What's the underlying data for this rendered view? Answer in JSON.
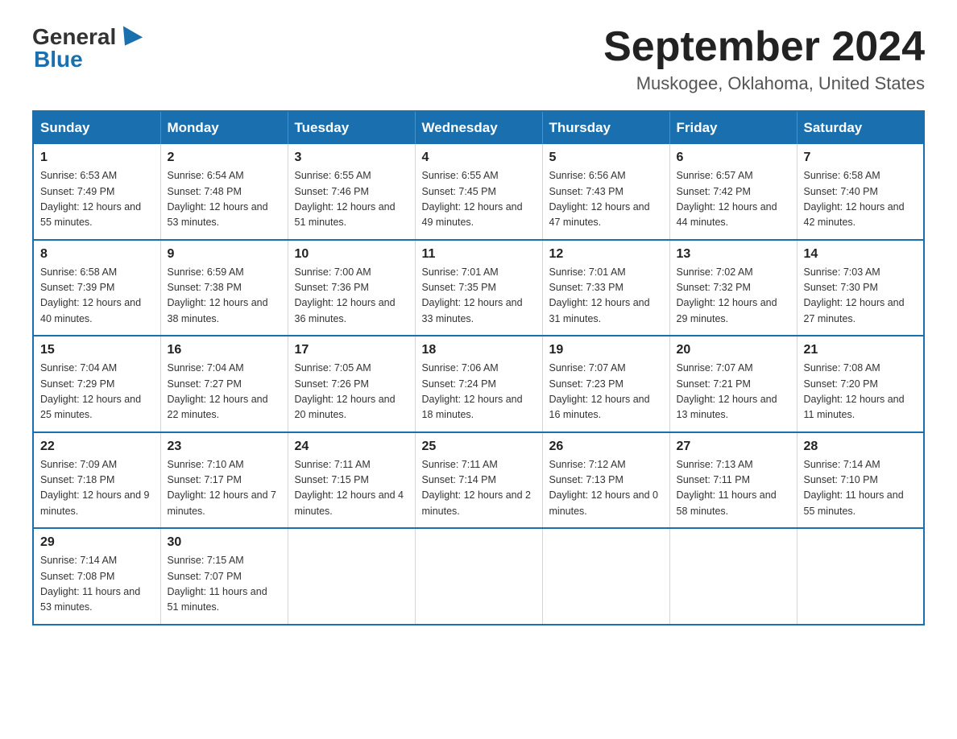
{
  "logo": {
    "general": "General",
    "blue": "Blue"
  },
  "title": "September 2024",
  "location": "Muskogee, Oklahoma, United States",
  "headers": [
    "Sunday",
    "Monday",
    "Tuesday",
    "Wednesday",
    "Thursday",
    "Friday",
    "Saturday"
  ],
  "weeks": [
    [
      {
        "day": "1",
        "sunrise": "6:53 AM",
        "sunset": "7:49 PM",
        "daylight": "12 hours and 55 minutes."
      },
      {
        "day": "2",
        "sunrise": "6:54 AM",
        "sunset": "7:48 PM",
        "daylight": "12 hours and 53 minutes."
      },
      {
        "day": "3",
        "sunrise": "6:55 AM",
        "sunset": "7:46 PM",
        "daylight": "12 hours and 51 minutes."
      },
      {
        "day": "4",
        "sunrise": "6:55 AM",
        "sunset": "7:45 PM",
        "daylight": "12 hours and 49 minutes."
      },
      {
        "day": "5",
        "sunrise": "6:56 AM",
        "sunset": "7:43 PM",
        "daylight": "12 hours and 47 minutes."
      },
      {
        "day": "6",
        "sunrise": "6:57 AM",
        "sunset": "7:42 PM",
        "daylight": "12 hours and 44 minutes."
      },
      {
        "day": "7",
        "sunrise": "6:58 AM",
        "sunset": "7:40 PM",
        "daylight": "12 hours and 42 minutes."
      }
    ],
    [
      {
        "day": "8",
        "sunrise": "6:58 AM",
        "sunset": "7:39 PM",
        "daylight": "12 hours and 40 minutes."
      },
      {
        "day": "9",
        "sunrise": "6:59 AM",
        "sunset": "7:38 PM",
        "daylight": "12 hours and 38 minutes."
      },
      {
        "day": "10",
        "sunrise": "7:00 AM",
        "sunset": "7:36 PM",
        "daylight": "12 hours and 36 minutes."
      },
      {
        "day": "11",
        "sunrise": "7:01 AM",
        "sunset": "7:35 PM",
        "daylight": "12 hours and 33 minutes."
      },
      {
        "day": "12",
        "sunrise": "7:01 AM",
        "sunset": "7:33 PM",
        "daylight": "12 hours and 31 minutes."
      },
      {
        "day": "13",
        "sunrise": "7:02 AM",
        "sunset": "7:32 PM",
        "daylight": "12 hours and 29 minutes."
      },
      {
        "day": "14",
        "sunrise": "7:03 AM",
        "sunset": "7:30 PM",
        "daylight": "12 hours and 27 minutes."
      }
    ],
    [
      {
        "day": "15",
        "sunrise": "7:04 AM",
        "sunset": "7:29 PM",
        "daylight": "12 hours and 25 minutes."
      },
      {
        "day": "16",
        "sunrise": "7:04 AM",
        "sunset": "7:27 PM",
        "daylight": "12 hours and 22 minutes."
      },
      {
        "day": "17",
        "sunrise": "7:05 AM",
        "sunset": "7:26 PM",
        "daylight": "12 hours and 20 minutes."
      },
      {
        "day": "18",
        "sunrise": "7:06 AM",
        "sunset": "7:24 PM",
        "daylight": "12 hours and 18 minutes."
      },
      {
        "day": "19",
        "sunrise": "7:07 AM",
        "sunset": "7:23 PM",
        "daylight": "12 hours and 16 minutes."
      },
      {
        "day": "20",
        "sunrise": "7:07 AM",
        "sunset": "7:21 PM",
        "daylight": "12 hours and 13 minutes."
      },
      {
        "day": "21",
        "sunrise": "7:08 AM",
        "sunset": "7:20 PM",
        "daylight": "12 hours and 11 minutes."
      }
    ],
    [
      {
        "day": "22",
        "sunrise": "7:09 AM",
        "sunset": "7:18 PM",
        "daylight": "12 hours and 9 minutes."
      },
      {
        "day": "23",
        "sunrise": "7:10 AM",
        "sunset": "7:17 PM",
        "daylight": "12 hours and 7 minutes."
      },
      {
        "day": "24",
        "sunrise": "7:11 AM",
        "sunset": "7:15 PM",
        "daylight": "12 hours and 4 minutes."
      },
      {
        "day": "25",
        "sunrise": "7:11 AM",
        "sunset": "7:14 PM",
        "daylight": "12 hours and 2 minutes."
      },
      {
        "day": "26",
        "sunrise": "7:12 AM",
        "sunset": "7:13 PM",
        "daylight": "12 hours and 0 minutes."
      },
      {
        "day": "27",
        "sunrise": "7:13 AM",
        "sunset": "7:11 PM",
        "daylight": "11 hours and 58 minutes."
      },
      {
        "day": "28",
        "sunrise": "7:14 AM",
        "sunset": "7:10 PM",
        "daylight": "11 hours and 55 minutes."
      }
    ],
    [
      {
        "day": "29",
        "sunrise": "7:14 AM",
        "sunset": "7:08 PM",
        "daylight": "11 hours and 53 minutes."
      },
      {
        "day": "30",
        "sunrise": "7:15 AM",
        "sunset": "7:07 PM",
        "daylight": "11 hours and 51 minutes."
      },
      null,
      null,
      null,
      null,
      null
    ]
  ]
}
